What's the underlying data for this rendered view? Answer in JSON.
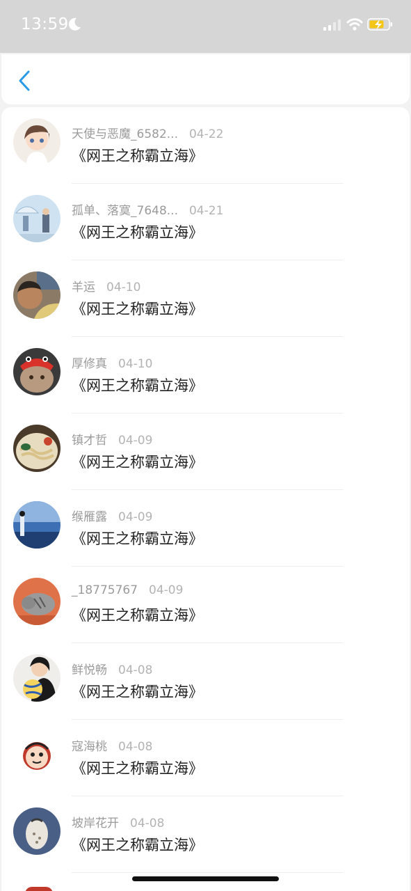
{
  "status_bar": {
    "time": "13:59",
    "icons": [
      "moon-icon",
      "signal-icon",
      "wifi-icon",
      "battery-charging-icon"
    ],
    "battery_color": "#f5c518"
  },
  "nav": {
    "back_icon": "chevron-left-icon",
    "accent": "#2b9be8"
  },
  "list": [
    {
      "name": "天使与恶魔_6582...",
      "date": "04-22",
      "title": "《网王之称霸立海》",
      "avatar": "anime-girl"
    },
    {
      "name": "孤单、落寞_7648...",
      "date": "04-21",
      "title": "《网王之称霸立海》",
      "avatar": "umbrella-couple"
    },
    {
      "name": "羊运",
      "date": "04-10",
      "title": "《网王之称霸立海》",
      "avatar": "person-selfie"
    },
    {
      "name": "厚修真",
      "date": "04-10",
      "title": "《网王之称霸立海》",
      "avatar": "cat-crab-hat"
    },
    {
      "name": "镇才哲",
      "date": "04-09",
      "title": "《网王之称霸立海》",
      "avatar": "noodle-bowl"
    },
    {
      "name": "缑雁露",
      "date": "04-09",
      "title": "《网王之称霸立海》",
      "avatar": "blue-scenery"
    },
    {
      "name": "_18775767",
      "date": "04-09",
      "title": "《网王之称霸立海》",
      "avatar": "orange-cat"
    },
    {
      "name": "鲜悦畅",
      "date": "04-08",
      "title": "《网王之称霸立海》",
      "avatar": "girl-volleyball"
    },
    {
      "name": "寇海桃",
      "date": "04-08",
      "title": "《网王之称霸立海》",
      "avatar": "cartoon-face"
    },
    {
      "name": "坡岸花开",
      "date": "04-08",
      "title": "《网王之称霸立海》",
      "avatar": "rice-ball"
    }
  ]
}
